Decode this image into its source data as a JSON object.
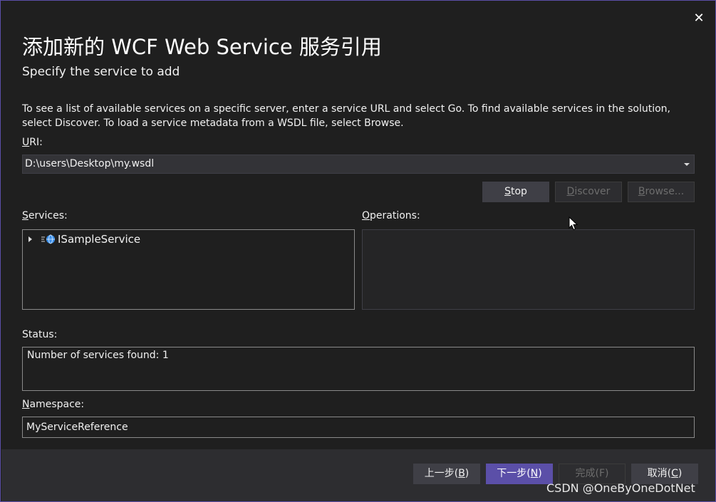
{
  "dialog": {
    "close_glyph": "✕",
    "title": "添加新的 WCF Web Service 服务引用",
    "subtitle": "Specify the service to add",
    "instructions": "To see a list of available services on a specific server, enter a service URL and select Go. To find available services in the solution, select Discover.  To load a service metadata from a WSDL file, select Browse."
  },
  "uri": {
    "label_access": "U",
    "label_rest": "RI:",
    "value": "D:\\users\\Desktop\\my.wsdl"
  },
  "actions": {
    "stop_access": "S",
    "stop_rest": "top",
    "discover_access": "D",
    "discover_rest": "iscover",
    "browse_access": "B",
    "browse_rest": "rowse..."
  },
  "services": {
    "label_access": "S",
    "label_rest": "ervices:",
    "items": [
      {
        "label": "ISampleService",
        "icon": "service-globe-icon"
      }
    ]
  },
  "operations": {
    "label_access": "O",
    "label_rest": "perations:"
  },
  "status": {
    "label": "Status:",
    "text": "Number of services found: 1"
  },
  "namespace": {
    "label_access": "N",
    "label_rest": "amespace:",
    "value": "MyServiceReference"
  },
  "footer": {
    "prev_label": "上一步(",
    "prev_access": "B",
    "prev_close": ")",
    "next_label": "下一步(",
    "next_access": "N",
    "next_close": ")",
    "finish_label": "完成(",
    "finish_access": "F",
    "finish_close": ")",
    "cancel_label": "取消(",
    "cancel_access": "C",
    "cancel_close": ")"
  },
  "watermark": "CSDN @OneByOneDotNet",
  "colors": {
    "background": "#1f1f1f",
    "accent": "#5b4fa8",
    "footer": "#2d2d30",
    "disabled_text": "#6d6d6d"
  }
}
